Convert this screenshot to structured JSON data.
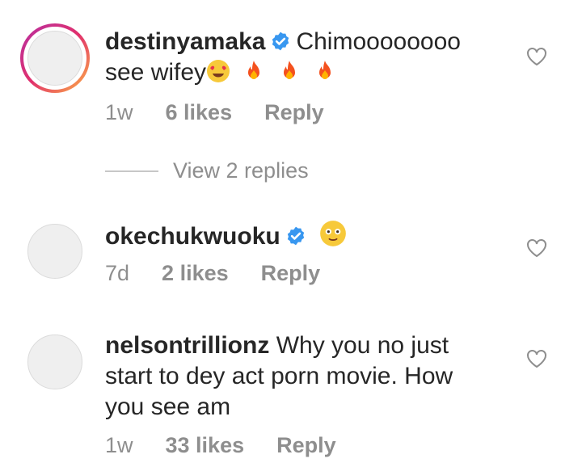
{
  "comments": [
    {
      "username": "destinyamaka",
      "verified": true,
      "has_story_ring": true,
      "text_line1": "Chimoooooooo",
      "text_line2": "see wifey",
      "emojis": [
        "heart-eyes-emoji",
        "fire-emoji",
        "fire-emoji",
        "fire-emoji"
      ],
      "time": "1w",
      "likes": "6 likes",
      "reply_label": "Reply",
      "view_replies": "View 2 replies"
    },
    {
      "username": "okechukwuoku",
      "verified": true,
      "has_story_ring": false,
      "text_line1": "",
      "emojis": [
        "flushed-smile-emoji"
      ],
      "time": "7d",
      "likes": "2 likes",
      "reply_label": "Reply"
    },
    {
      "username": "nelsontrillionz",
      "verified": false,
      "has_story_ring": false,
      "text_line1": "Why you no just",
      "text_line2": "start to dey act porn movie. How",
      "text_line3": "you see am",
      "time": "1w",
      "likes": "33 likes",
      "reply_label": "Reply"
    }
  ],
  "colors": {
    "verified_badge": "#3897f0",
    "meta_text": "#8e8e8e",
    "story_ring_start": "#c13584",
    "story_ring_end": "#fcaf45"
  },
  "icons": {
    "like": "heart-outline-icon",
    "verified": "verified-badge-icon"
  }
}
